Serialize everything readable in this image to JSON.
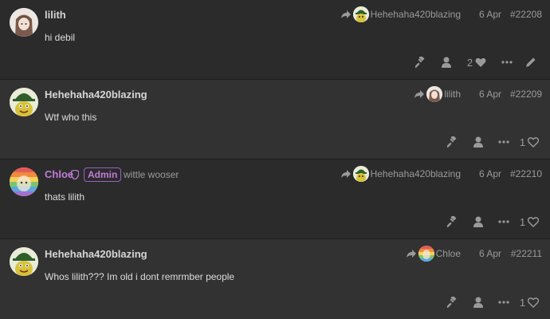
{
  "posts": [
    {
      "author": "lilith",
      "avatar": "lilith",
      "reply_to": {
        "name": "Hehehaha420blazing",
        "avatar": "heheh"
      },
      "date": "6 Apr",
      "number": "#22208",
      "body": "hi debil",
      "likes": "2",
      "liked": true,
      "flag_button": false
    },
    {
      "author": "Hehehaha420blazing",
      "avatar": "heheh",
      "reply_to": {
        "name": "lilith",
        "avatar": "lilith"
      },
      "date": "6 Apr",
      "number": "#22209",
      "body": "Wtf who this",
      "likes": "1",
      "liked": false
    },
    {
      "author": "Chloe",
      "avatar": "chloe",
      "badge": "Admin",
      "title": "wittle wooser",
      "reply_to": {
        "name": "Hehehaha420blazing",
        "avatar": "heheh"
      },
      "date": "6 Apr",
      "number": "#22210",
      "body": "thats lilith",
      "likes": "1",
      "liked": false
    },
    {
      "author": "Hehehaha420blazing",
      "avatar": "heheh",
      "reply_to": {
        "name": "Chloe",
        "avatar": "chloe"
      },
      "date": "6 Apr",
      "number": "#22211",
      "body": "Whos lilith??? Im old i dont remrmber people",
      "likes": "1",
      "liked": false
    }
  ],
  "icons": {
    "reply_arrow": "share-arrow-icon",
    "admin": "shield-icon",
    "hammer": "gavel-icon",
    "user": "user-icon",
    "more": "ellipsis-icon",
    "like": "heart-icon",
    "edit": "pencil-icon"
  },
  "colors": {
    "background": "#242424",
    "post_bg": "#2b2b2b",
    "post_bg_alt": "#323232",
    "admin_purple": "#c27bd8",
    "muted_text": "#9a9a9a"
  }
}
